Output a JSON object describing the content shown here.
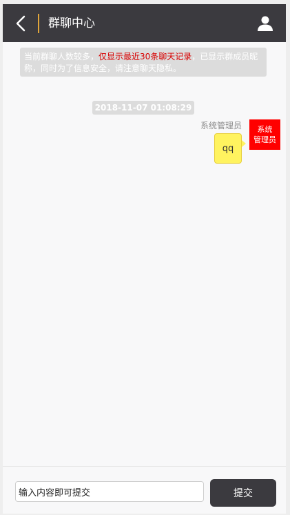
{
  "header": {
    "title": "群聊中心",
    "back_icon": "chevron-left-icon",
    "user_icon": "user-icon"
  },
  "notice": {
    "prefix": "当前群聊人数较多，",
    "highlight": "仅显示最近30条聊天记录",
    "suffix": "，已显示群成员昵称，同时为了信息安全，请注意聊天隐私。"
  },
  "messages": [
    {
      "timestamp": "2018-11-07 01:08:29",
      "sender": "系统管理员",
      "text": "qq",
      "avatar_line1": "系统",
      "avatar_line2": "管理员"
    }
  ],
  "input": {
    "value": "输入内容即可提交",
    "placeholder": "输入内容即可提交",
    "submit_label": "提交"
  },
  "colors": {
    "header_bg": "#3b3a3f",
    "accent": "#e0a53a",
    "highlight": "#d80000",
    "bubble": "#fff35f",
    "avatar_bg": "#ff0000"
  }
}
